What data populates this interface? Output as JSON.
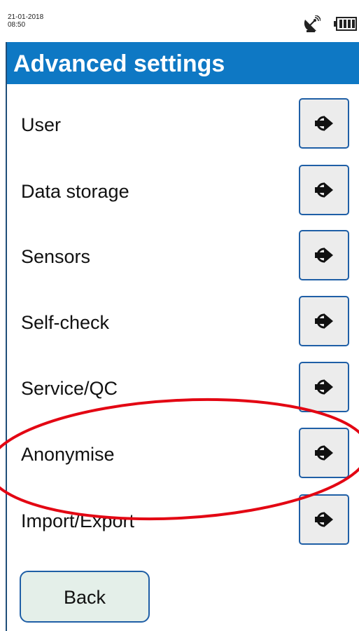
{
  "status_bar": {
    "date": "21-01-2018",
    "time": "08:50",
    "icons": [
      "satellite-icon",
      "battery-icon"
    ]
  },
  "header": {
    "title": "Advanced settings"
  },
  "menu": {
    "items": [
      {
        "label": "User",
        "icon": "arrow-right-icon"
      },
      {
        "label": "Data storage",
        "icon": "arrow-right-icon"
      },
      {
        "label": "Sensors",
        "icon": "arrow-right-icon"
      },
      {
        "label": "Self-check",
        "icon": "arrow-right-icon"
      },
      {
        "label": "Service/QC",
        "icon": "arrow-right-icon"
      },
      {
        "label": "Anonymise",
        "icon": "arrow-right-icon"
      },
      {
        "label": "Import/Export",
        "icon": "arrow-right-icon"
      }
    ]
  },
  "footer": {
    "back_label": "Back"
  },
  "colors": {
    "header_bg": "#0e78c4",
    "button_border": "#1f5fa6",
    "button_bg": "#ececec",
    "back_bg": "#e4efe9",
    "highlight": "#e30613"
  }
}
